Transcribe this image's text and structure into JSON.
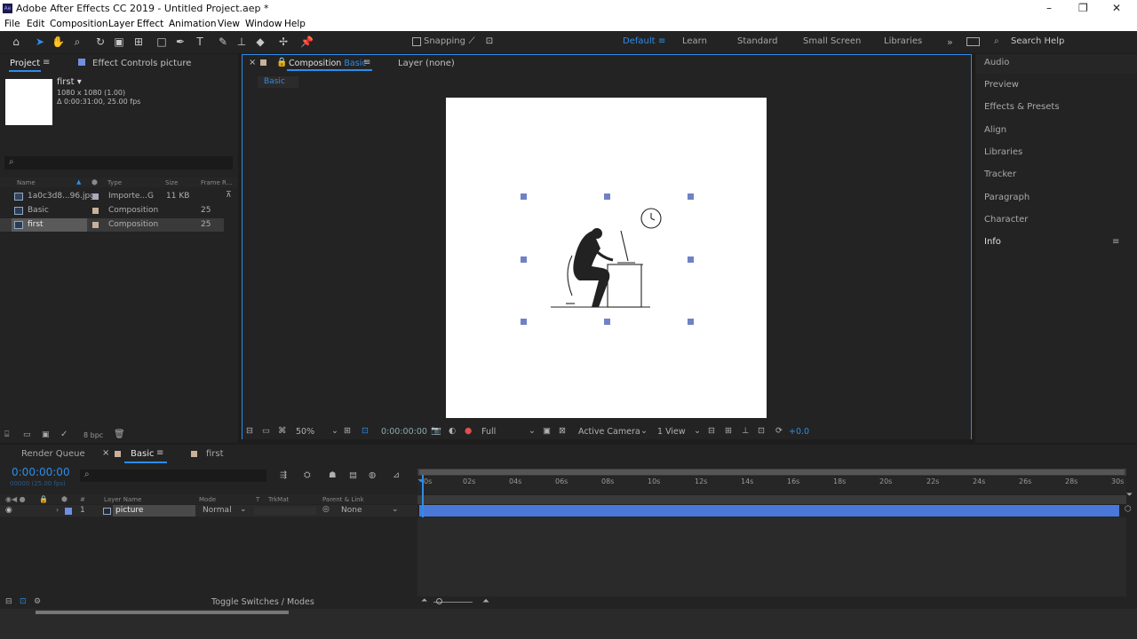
{
  "app": {
    "title": "Adobe After Effects CC 2019 - Untitled Project.aep *"
  },
  "menu": [
    "File",
    "Edit",
    "Composition",
    "Layer",
    "Effect",
    "Animation",
    "View",
    "Window",
    "Help"
  ],
  "toolbar": {
    "snapping": "Snapping",
    "workspaces": [
      "Default",
      "Learn",
      "Standard",
      "Small Screen",
      "Libraries"
    ],
    "search_help": "Search Help"
  },
  "project": {
    "tab": "Project",
    "effect_controls_tab": "Effect Controls picture",
    "preview_name": "first",
    "preview_info1": "1080 x 1080 (1.00)",
    "preview_info2": "Δ 0:00:31:00, 25.00 fps",
    "columns": {
      "name": "Name",
      "type": "Type",
      "size": "Size",
      "frame_rate": "Frame R..."
    },
    "items": [
      {
        "name": "1a0c3d8...96.jpg",
        "type": "Importe...G",
        "size": "11 KB",
        "frame_rate": ""
      },
      {
        "name": "Basic",
        "type": "Composition",
        "size": "",
        "frame_rate": "25"
      },
      {
        "name": "first",
        "type": "Composition",
        "size": "",
        "frame_rate": "25"
      }
    ],
    "bpc": "8 bpc"
  },
  "composition": {
    "tab": "Composition",
    "tab_name": "Basic",
    "layer_tab": "Layer (none)",
    "breadcrumb": "Basic",
    "zoom": "50%",
    "timecode": "0:00:00:00",
    "resolution": "Full",
    "camera": "Active Camera",
    "views": "1 View",
    "exposure": "+0.0"
  },
  "right_panels": [
    "Audio",
    "Preview",
    "Effects & Presets",
    "Align",
    "Libraries",
    "Tracker",
    "Paragraph",
    "Character",
    "Info"
  ],
  "timeline": {
    "render_queue_tab": "Render Queue",
    "basic_tab": "Basic",
    "first_tab": "first",
    "timecode": "0:00:00:00",
    "frame_info": "00000 (25.00 fps)",
    "columns": {
      "hash": "#",
      "layer_name": "Layer Name",
      "mode": "Mode",
      "t": "T",
      "trkmat": "TrkMat",
      "parent": "Parent & Link"
    },
    "layers": [
      {
        "num": "1",
        "name": "picture",
        "mode": "Normal",
        "parent": "None"
      }
    ],
    "ticks": [
      "0s",
      "02s",
      "04s",
      "06s",
      "08s",
      "10s",
      "12s",
      "14s",
      "16s",
      "18s",
      "20s",
      "22s",
      "24s",
      "26s",
      "28s",
      "30s"
    ],
    "toggle_label": "Toggle Switches / Modes"
  },
  "colors": {
    "accent": "#2d8ceb",
    "layer_bar": "#4a78d8",
    "label_tan": "#c7b299",
    "label_blue": "#6f8fe0"
  }
}
